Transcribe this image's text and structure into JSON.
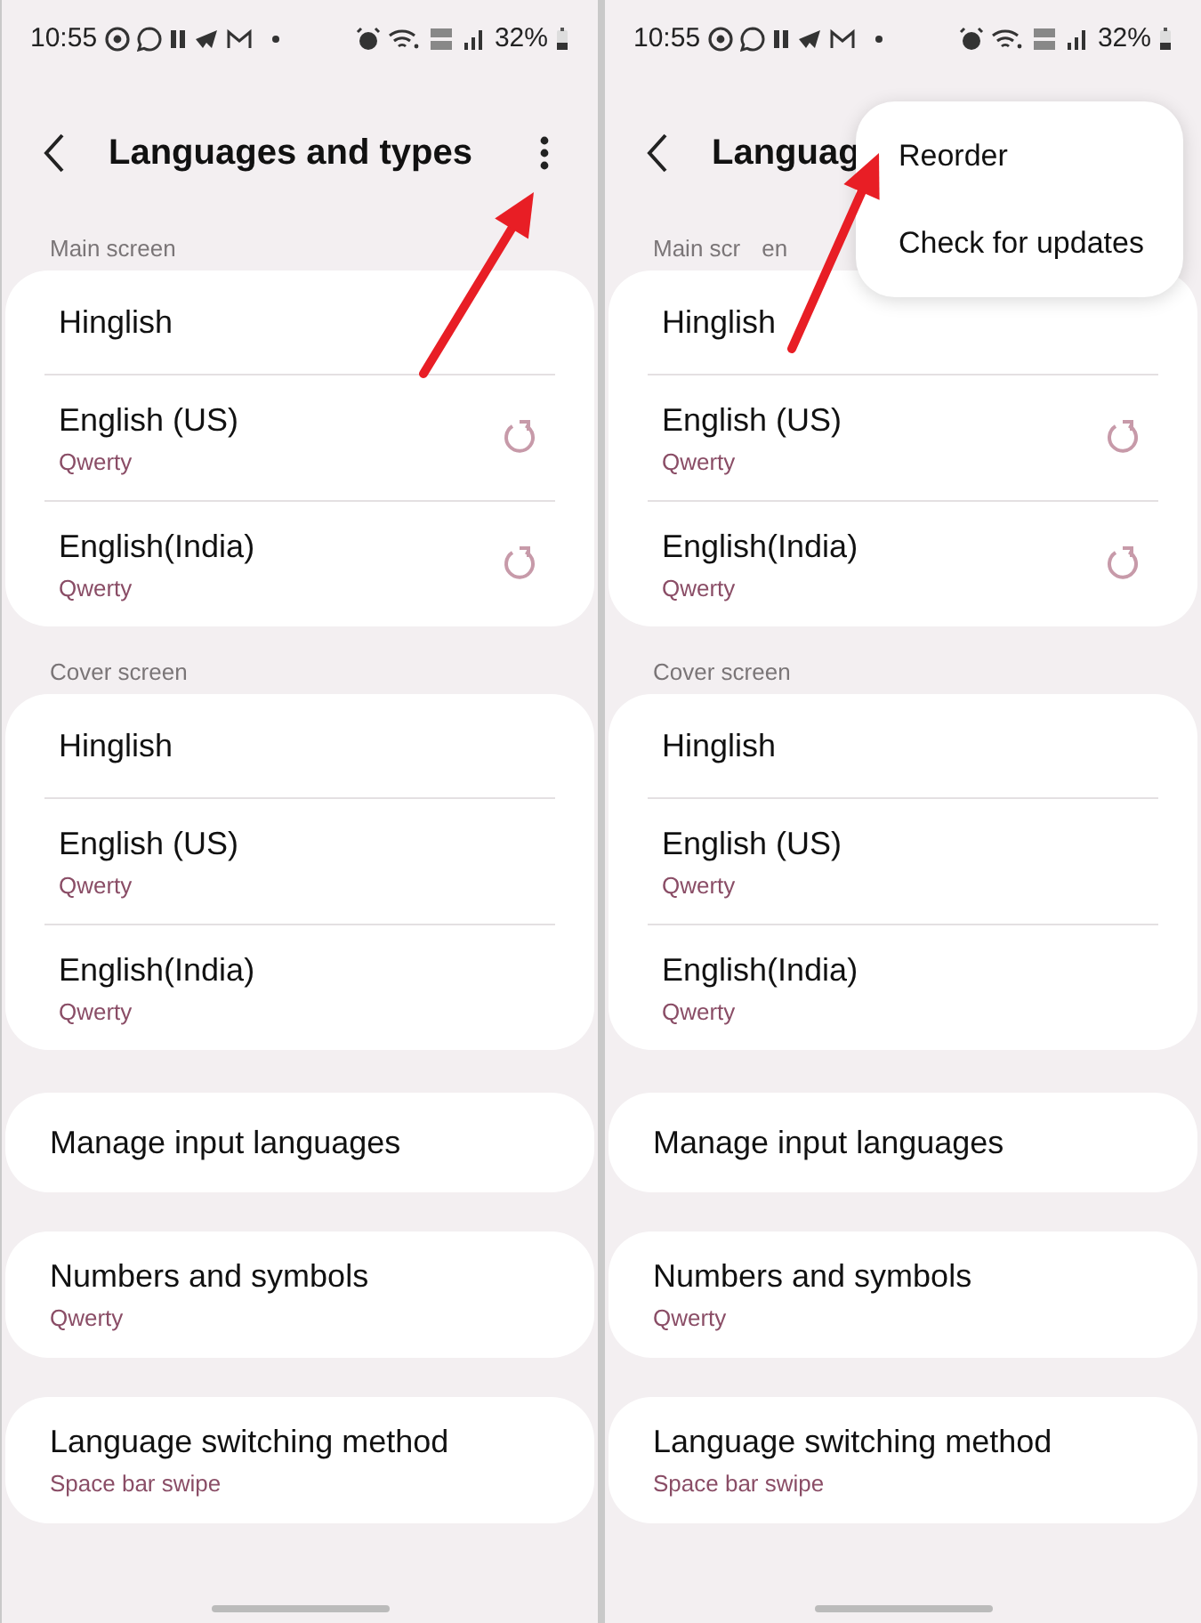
{
  "screens": [
    {
      "status_bar": {
        "time": "10:55",
        "battery": "32%"
      },
      "title": "Languages and types",
      "more_button": true,
      "groups": [
        {
          "label": "Main screen",
          "items": [
            {
              "name": "Hinglish",
              "reset": false
            },
            {
              "name": "English (US)",
              "subtitle": "Qwerty",
              "reset": true
            },
            {
              "name": "English(India)",
              "subtitle": "Qwerty",
              "reset": true
            }
          ]
        },
        {
          "label": "Cover screen",
          "items": [
            {
              "name": "Hinglish",
              "reset": false
            },
            {
              "name": "English (US)",
              "subtitle": "Qwerty",
              "reset": false
            },
            {
              "name": "English(India)",
              "subtitle": "Qwerty",
              "reset": false
            }
          ]
        }
      ],
      "cards": [
        {
          "label": "Manage input languages"
        },
        {
          "label": "Numbers and symbols",
          "value": "Qwerty"
        },
        {
          "label": "Language switching method",
          "value": "Space bar swipe"
        }
      ]
    },
    {
      "status_bar": {
        "time": "10:55",
        "battery": "32%"
      },
      "title": "Languag",
      "more_button": false,
      "menu": {
        "items": [
          "Reorder",
          "Check for updates"
        ]
      },
      "groups": [
        {
          "label": "Main scr",
          "label_rest": "en",
          "items": [
            {
              "name": "Hinglish",
              "reset": false
            },
            {
              "name": "English (US)",
              "subtitle": "Qwerty",
              "reset": true
            },
            {
              "name": "English(India)",
              "subtitle": "Qwerty",
              "reset": true
            }
          ]
        },
        {
          "label": "Cover screen",
          "items": [
            {
              "name": "Hinglish",
              "reset": false
            },
            {
              "name": "English (US)",
              "subtitle": "Qwerty",
              "reset": false
            },
            {
              "name": "English(India)",
              "subtitle": "Qwerty",
              "reset": false
            }
          ]
        }
      ],
      "cards": [
        {
          "label": "Manage input languages"
        },
        {
          "label": "Numbers and symbols",
          "value": "Qwerty"
        },
        {
          "label": "Language switching method",
          "value": "Space bar swipe"
        }
      ]
    }
  ],
  "annotations": [
    {
      "kind": "arrow"
    },
    {
      "kind": "arrow"
    }
  ]
}
